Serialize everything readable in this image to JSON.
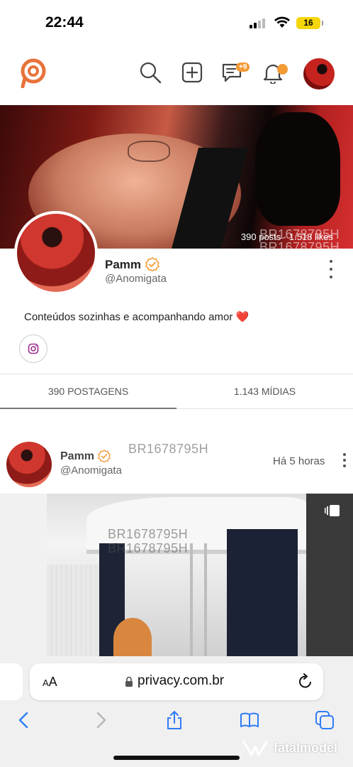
{
  "status_bar": {
    "time": "22:44",
    "battery": "16"
  },
  "header": {
    "messages_badge": "+9"
  },
  "profile": {
    "cover_stats": "390 posts · 1.518 likes",
    "watermark": "BR1678795H",
    "name": "Pamm",
    "handle": "@Anomigata",
    "bio": "Conteúdos sozinhas e acompanhando amor",
    "bio_emoji": "❤️"
  },
  "tabs": [
    {
      "label": "390 POSTAGENS",
      "active": true
    },
    {
      "label": "1.143 MÍDIAS",
      "active": false
    }
  ],
  "post": {
    "name": "Pamm",
    "handle": "@Anomigata",
    "time": "Há 5 horas",
    "watermark": "BR1678795H"
  },
  "browser": {
    "aa_label": "AA",
    "url": "privacy.com.br"
  },
  "overlay": {
    "brand": "fatalmodel"
  },
  "colors": {
    "accent": "#f39a35",
    "brand": "#e8723a",
    "heart": "#d8322a"
  }
}
